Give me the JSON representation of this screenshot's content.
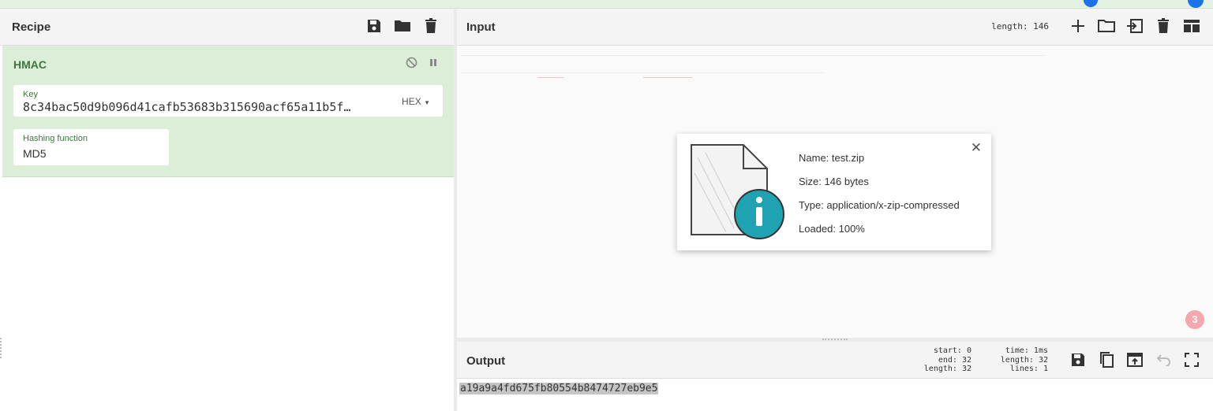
{
  "recipe": {
    "title": "Recipe",
    "operation": {
      "name": "HMAC",
      "key_label": "Key",
      "key_value": "8c34bac50d9b096d41cafb53683b315690acf65a11b5f…",
      "key_format": "HEX",
      "hash_label": "Hashing function",
      "hash_value": "MD5"
    }
  },
  "input": {
    "title": "Input",
    "length_label": "length:",
    "length_value": "146",
    "file": {
      "name_label": "Name: test.zip",
      "size_label": "Size: 146 bytes",
      "type_label": "Type: application/x-zip-compressed",
      "loaded_label": "Loaded: 100%"
    },
    "badge": "3"
  },
  "output": {
    "title": "Output",
    "stats": {
      "start": "start:  0",
      "end": "end: 32",
      "length": "length: 32",
      "time": "time:  1ms",
      "out_length": "length:  32",
      "lines": "lines:   1"
    },
    "value": "a19a9a4fd675fb80554b8474727eb9e5"
  },
  "colors": {
    "accent_blue": "#1a73e8",
    "operation_bg": "#dcedd8",
    "label_green": "#3c763d",
    "info_teal": "#1fa2b2"
  }
}
